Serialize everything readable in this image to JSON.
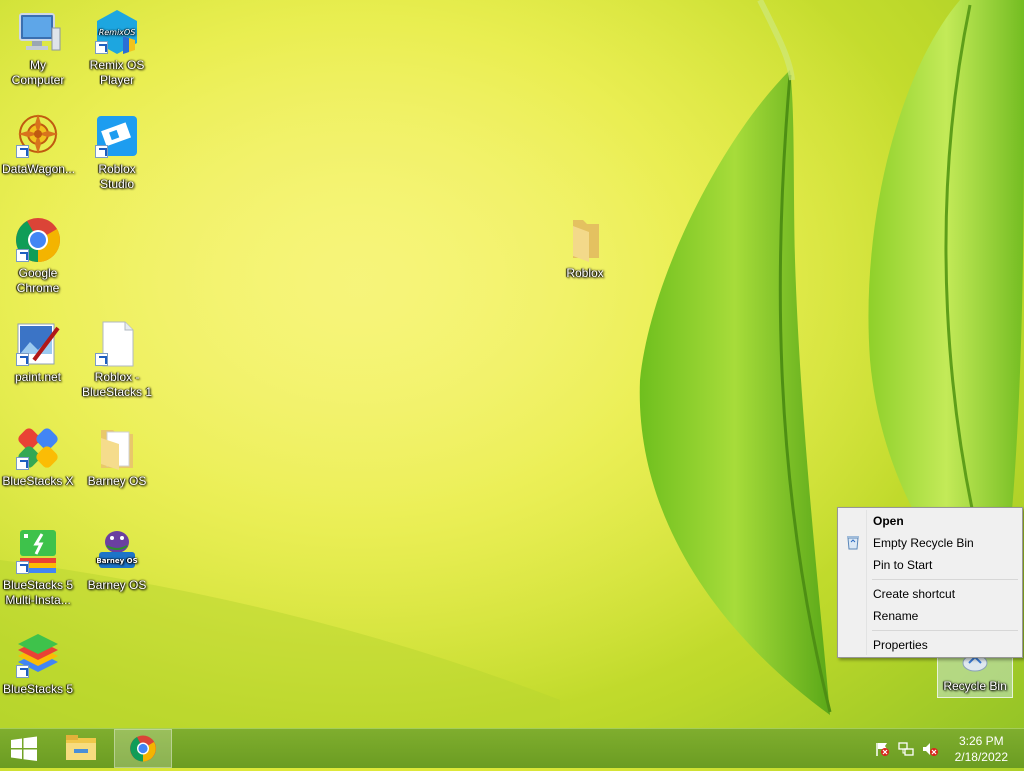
{
  "desktop": {
    "icons": [
      {
        "id": "my-computer",
        "label": "My Computer"
      },
      {
        "id": "remix-os",
        "label": "Remix OS Player",
        "badge": "RemixOS"
      },
      {
        "id": "datawagon",
        "label": "DataWagon..."
      },
      {
        "id": "roblox-studio",
        "label": "Roblox Studio"
      },
      {
        "id": "google-chrome",
        "label": "Google Chrome"
      },
      {
        "id": "paint-net",
        "label": "paint.net"
      },
      {
        "id": "roblox-bluestacks",
        "label": "Roblox - BlueStacks 1"
      },
      {
        "id": "bluestacks-x",
        "label": "BlueStacks X"
      },
      {
        "id": "barney-os-folder",
        "label": "Barney OS"
      },
      {
        "id": "bluestacks5-multi",
        "label": "BlueStacks 5 Multi-Insta..."
      },
      {
        "id": "barney-os-app",
        "label": "Barney OS",
        "badge": "Barney OS"
      },
      {
        "id": "bluestacks5",
        "label": "BlueStacks 5"
      },
      {
        "id": "roblox-folder",
        "label": "Roblox"
      },
      {
        "id": "recycle-bin",
        "label": "Recycle Bin"
      }
    ]
  },
  "context_menu": {
    "items": [
      {
        "label": "Open"
      },
      {
        "label": "Empty Recycle Bin"
      },
      {
        "label": "Pin to Start"
      },
      {
        "label": "Create shortcut"
      },
      {
        "label": "Rename"
      },
      {
        "label": "Properties"
      }
    ]
  },
  "taskbar": {
    "start_icon": "windows-logo-icon",
    "pinned": [
      {
        "name": "file-explorer-icon"
      },
      {
        "name": "chrome-icon",
        "active": true
      }
    ]
  },
  "tray": {
    "time": "3:26 PM",
    "date": "2/18/2022"
  },
  "colors": {
    "taskbar": "#7aaa2c",
    "wallpaper": "#e2ea3a",
    "menu_bg": "#f0f0f0"
  }
}
